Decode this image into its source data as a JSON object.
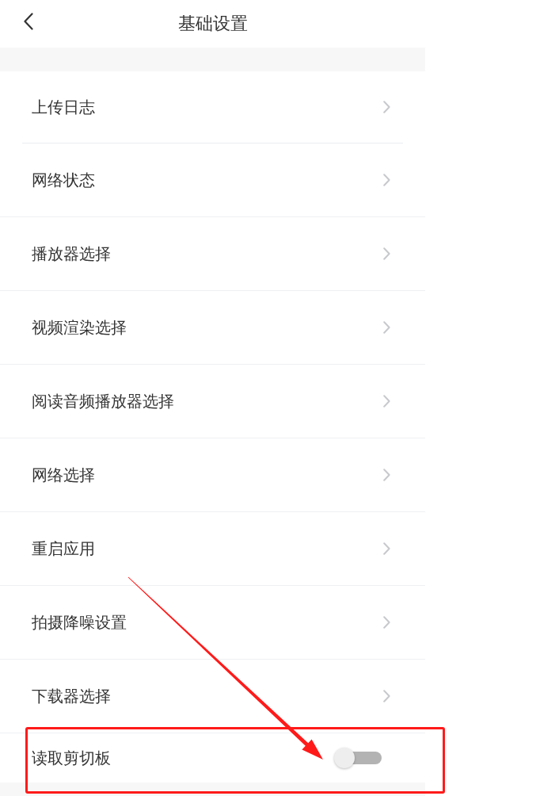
{
  "header": {
    "title": "基础设置"
  },
  "rows": [
    {
      "kind": "link",
      "label": "上传日志"
    },
    {
      "kind": "link",
      "label": "网络状态"
    },
    {
      "kind": "link",
      "label": "播放器选择"
    },
    {
      "kind": "link",
      "label": "视频渲染选择"
    },
    {
      "kind": "link",
      "label": "阅读音频播放器选择"
    },
    {
      "kind": "link",
      "label": "网络选择"
    },
    {
      "kind": "link",
      "label": "重启应用"
    },
    {
      "kind": "link",
      "label": "拍摄降噪设置"
    },
    {
      "kind": "link",
      "label": "下载器选择"
    },
    {
      "kind": "toggle",
      "label": "读取剪切板",
      "on": false
    }
  ]
}
